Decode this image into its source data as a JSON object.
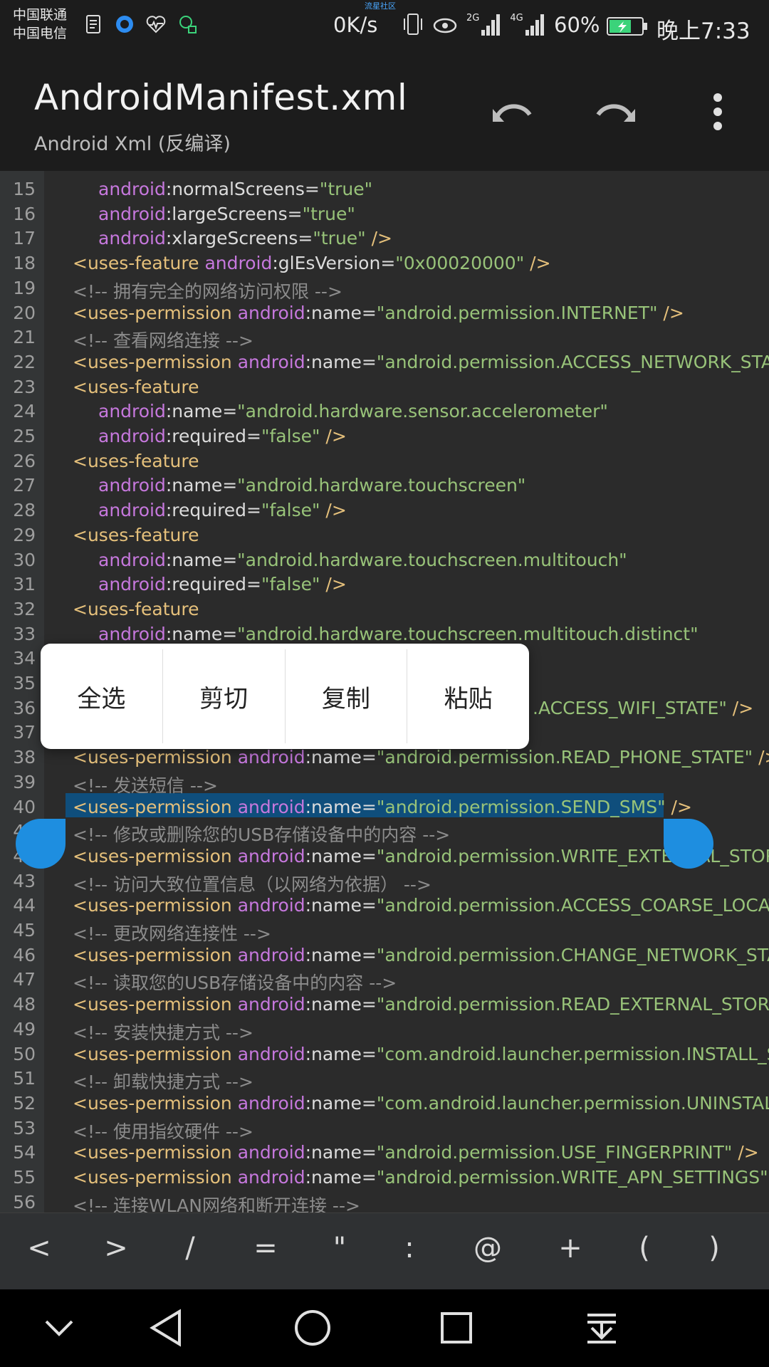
{
  "status": {
    "carrier1": "中国联通",
    "carrier2": "中国电信",
    "community": "流星社区",
    "netspeed": "0K/s",
    "net_2g": "2G",
    "net_4g": "4G",
    "battery_pct": "60%",
    "clock": "晚上7:33"
  },
  "appbar": {
    "title": "AndroidManifest.xml",
    "subtitle": "Android Xml (反编译)"
  },
  "editor": {
    "lines": [
      {
        "n": "15",
        "tokens": [
          [
            "ns",
            "android"
          ],
          [
            "at",
            ":normalScreens="
          ],
          [
            "st",
            "\"true\""
          ]
        ],
        "indent": 2
      },
      {
        "n": "16",
        "tokens": [
          [
            "ns",
            "android"
          ],
          [
            "at",
            ":largeScreens="
          ],
          [
            "st",
            "\"true\""
          ]
        ],
        "indent": 2
      },
      {
        "n": "17",
        "tokens": [
          [
            "ns",
            "android"
          ],
          [
            "at",
            ":xlargeScreens="
          ],
          [
            "st",
            "\"true\""
          ],
          [
            "pu",
            " />"
          ]
        ],
        "indent": 2
      },
      {
        "n": "18",
        "tokens": [
          [
            "tag",
            "<uses-feature "
          ],
          [
            "ns",
            "android"
          ],
          [
            "at",
            ":glEsVersion="
          ],
          [
            "st",
            "\"0x00020000\""
          ],
          [
            "pu",
            " />"
          ]
        ],
        "indent": 1
      },
      {
        "n": "19",
        "tokens": [
          [
            "cm",
            "<!-- 拥有完全的网络访问权限 -->"
          ]
        ],
        "indent": 1
      },
      {
        "n": "20",
        "tokens": [
          [
            "tag",
            "<uses-permission "
          ],
          [
            "ns",
            "android"
          ],
          [
            "at",
            ":name="
          ],
          [
            "st",
            "\"android.permission.INTERNET\""
          ],
          [
            "pu",
            " />"
          ]
        ],
        "indent": 1
      },
      {
        "n": "21",
        "tokens": [
          [
            "cm",
            "<!-- 查看网络连接 -->"
          ]
        ],
        "indent": 1
      },
      {
        "n": "22",
        "tokens": [
          [
            "tag",
            "<uses-permission "
          ],
          [
            "ns",
            "android"
          ],
          [
            "at",
            ":name="
          ],
          [
            "st",
            "\"android.permission.ACCESS_NETWORK_STAT"
          ]
        ],
        "indent": 1
      },
      {
        "n": "23",
        "tokens": [
          [
            "tag",
            "<uses-feature"
          ]
        ],
        "indent": 1
      },
      {
        "n": "24",
        "tokens": [
          [
            "ns",
            "android"
          ],
          [
            "at",
            ":name="
          ],
          [
            "st",
            "\"android.hardware.sensor.accelerometer\""
          ]
        ],
        "indent": 2
      },
      {
        "n": "25",
        "tokens": [
          [
            "ns",
            "android"
          ],
          [
            "at",
            ":required="
          ],
          [
            "st",
            "\"false\""
          ],
          [
            "pu",
            " />"
          ]
        ],
        "indent": 2
      },
      {
        "n": "26",
        "tokens": [
          [
            "tag",
            "<uses-feature"
          ]
        ],
        "indent": 1
      },
      {
        "n": "27",
        "tokens": [
          [
            "ns",
            "android"
          ],
          [
            "at",
            ":name="
          ],
          [
            "st",
            "\"android.hardware.touchscreen\""
          ]
        ],
        "indent": 2
      },
      {
        "n": "28",
        "tokens": [
          [
            "ns",
            "android"
          ],
          [
            "at",
            ":required="
          ],
          [
            "st",
            "\"false\""
          ],
          [
            "pu",
            " />"
          ]
        ],
        "indent": 2
      },
      {
        "n": "29",
        "tokens": [
          [
            "tag",
            "<uses-feature"
          ]
        ],
        "indent": 1
      },
      {
        "n": "30",
        "tokens": [
          [
            "ns",
            "android"
          ],
          [
            "at",
            ":name="
          ],
          [
            "st",
            "\"android.hardware.touchscreen.multitouch\""
          ]
        ],
        "indent": 2
      },
      {
        "n": "31",
        "tokens": [
          [
            "ns",
            "android"
          ],
          [
            "at",
            ":required="
          ],
          [
            "st",
            "\"false\""
          ],
          [
            "pu",
            " />"
          ]
        ],
        "indent": 2
      },
      {
        "n": "32",
        "tokens": [
          [
            "tag",
            "<uses-feature"
          ]
        ],
        "indent": 1
      },
      {
        "n": "33",
        "tokens": [
          [
            "ns",
            "android"
          ],
          [
            "at",
            ":name="
          ],
          [
            "st",
            "\"android.hardware.touchscreen.multitouch.distinct\""
          ]
        ],
        "indent": 2
      },
      {
        "n": "34",
        "tokens": [],
        "indent": 1
      },
      {
        "n": "35",
        "tokens": [],
        "indent": 1
      },
      {
        "n": "36",
        "tokens": [
          [
            "st",
            ".ACCESS_WIFI_STATE\""
          ],
          [
            "pu",
            " />"
          ]
        ],
        "indent": 0,
        "offset": 748
      },
      {
        "n": "37",
        "tokens": [],
        "indent": 1
      },
      {
        "n": "38",
        "tokens": [
          [
            "tag",
            "<uses-permission "
          ],
          [
            "ns",
            "android"
          ],
          [
            "at",
            ":name="
          ],
          [
            "st",
            "\"android.permission.READ_PHONE_STATE\""
          ],
          [
            "pu",
            " />"
          ]
        ],
        "indent": 1
      },
      {
        "n": "39",
        "tokens": [
          [
            "cm",
            "<!-- 发送短信 -->"
          ]
        ],
        "indent": 1
      },
      {
        "n": "40",
        "tokens": [
          [
            "tag",
            "<uses-permission "
          ],
          [
            "ns",
            "android"
          ],
          [
            "at",
            ":name="
          ],
          [
            "st",
            "\"android.permission.SEND_SMS\""
          ],
          [
            "pu",
            " />"
          ]
        ],
        "indent": 1
      },
      {
        "n": "41",
        "tokens": [
          [
            "cm",
            "<!-- 修改或删除您的USB存储设备中的内容 -->"
          ]
        ],
        "indent": 1
      },
      {
        "n": "42",
        "tokens": [
          [
            "tag",
            "<uses-permission "
          ],
          [
            "ns",
            "android"
          ],
          [
            "at",
            ":name="
          ],
          [
            "st",
            "\"android.permission.WRITE_EXTERNAL_STORA"
          ]
        ],
        "indent": 1
      },
      {
        "n": "43",
        "tokens": [
          [
            "cm",
            "<!-- 访问大致位置信息（以网络为依据） -->"
          ]
        ],
        "indent": 1
      },
      {
        "n": "44",
        "tokens": [
          [
            "tag",
            "<uses-permission "
          ],
          [
            "ns",
            "android"
          ],
          [
            "at",
            ":name="
          ],
          [
            "st",
            "\"android.permission.ACCESS_COARSE_LOCAT"
          ]
        ],
        "indent": 1
      },
      {
        "n": "45",
        "tokens": [
          [
            "cm",
            "<!-- 更改网络连接性 -->"
          ]
        ],
        "indent": 1
      },
      {
        "n": "46",
        "tokens": [
          [
            "tag",
            "<uses-permission "
          ],
          [
            "ns",
            "android"
          ],
          [
            "at",
            ":name="
          ],
          [
            "st",
            "\"android.permission.CHANGE_NETWORK_STAT"
          ]
        ],
        "indent": 1
      },
      {
        "n": "47",
        "tokens": [
          [
            "cm",
            "<!-- 读取您的USB存储设备中的内容 -->"
          ]
        ],
        "indent": 1
      },
      {
        "n": "48",
        "tokens": [
          [
            "tag",
            "<uses-permission "
          ],
          [
            "ns",
            "android"
          ],
          [
            "at",
            ":name="
          ],
          [
            "st",
            "\"android.permission.READ_EXTERNAL_STORAG"
          ]
        ],
        "indent": 1
      },
      {
        "n": "49",
        "tokens": [
          [
            "cm",
            "<!-- 安装快捷方式 -->"
          ]
        ],
        "indent": 1
      },
      {
        "n": "50",
        "tokens": [
          [
            "tag",
            "<uses-permission "
          ],
          [
            "ns",
            "android"
          ],
          [
            "at",
            ":name="
          ],
          [
            "st",
            "\"com.android.launcher.permission.INSTALL_SHO"
          ]
        ],
        "indent": 1
      },
      {
        "n": "51",
        "tokens": [
          [
            "cm",
            "<!-- 卸载快捷方式 -->"
          ]
        ],
        "indent": 1
      },
      {
        "n": "52",
        "tokens": [
          [
            "tag",
            "<uses-permission "
          ],
          [
            "ns",
            "android"
          ],
          [
            "at",
            ":name="
          ],
          [
            "st",
            "\"com.android.launcher.permission.UNINSTALL_"
          ]
        ],
        "indent": 1
      },
      {
        "n": "53",
        "tokens": [
          [
            "cm",
            "<!-- 使用指纹硬件 -->"
          ]
        ],
        "indent": 1
      },
      {
        "n": "54",
        "tokens": [
          [
            "tag",
            "<uses-permission "
          ],
          [
            "ns",
            "android"
          ],
          [
            "at",
            ":name="
          ],
          [
            "st",
            "\"android.permission.USE_FINGERPRINT\""
          ],
          [
            "pu",
            " />"
          ]
        ],
        "indent": 1
      },
      {
        "n": "55",
        "tokens": [
          [
            "tag",
            "<uses-permission "
          ],
          [
            "ns",
            "android"
          ],
          [
            "at",
            ":name="
          ],
          [
            "st",
            "\"android.permission.WRITE_APN_SETTINGS\""
          ],
          [
            "pu",
            " />"
          ]
        ],
        "indent": 1
      },
      {
        "n": "56",
        "tokens": [
          [
            "cm",
            "<!-- 连接WLAN网络和断开连接 -->"
          ]
        ],
        "indent": 1
      }
    ]
  },
  "context_menu": [
    "全选",
    "剪切",
    "复制",
    "粘贴"
  ],
  "symbols": [
    "<",
    ">",
    "/",
    "=",
    "\"",
    ":",
    "@",
    "+",
    "(",
    ")"
  ],
  "colors": {
    "tag": "#e5c07b",
    "namespace": "#c678dd",
    "string": "#98c379",
    "comment": "#8c8c8c",
    "selection": "#0f4e7c",
    "handle": "#1e8ee0"
  }
}
